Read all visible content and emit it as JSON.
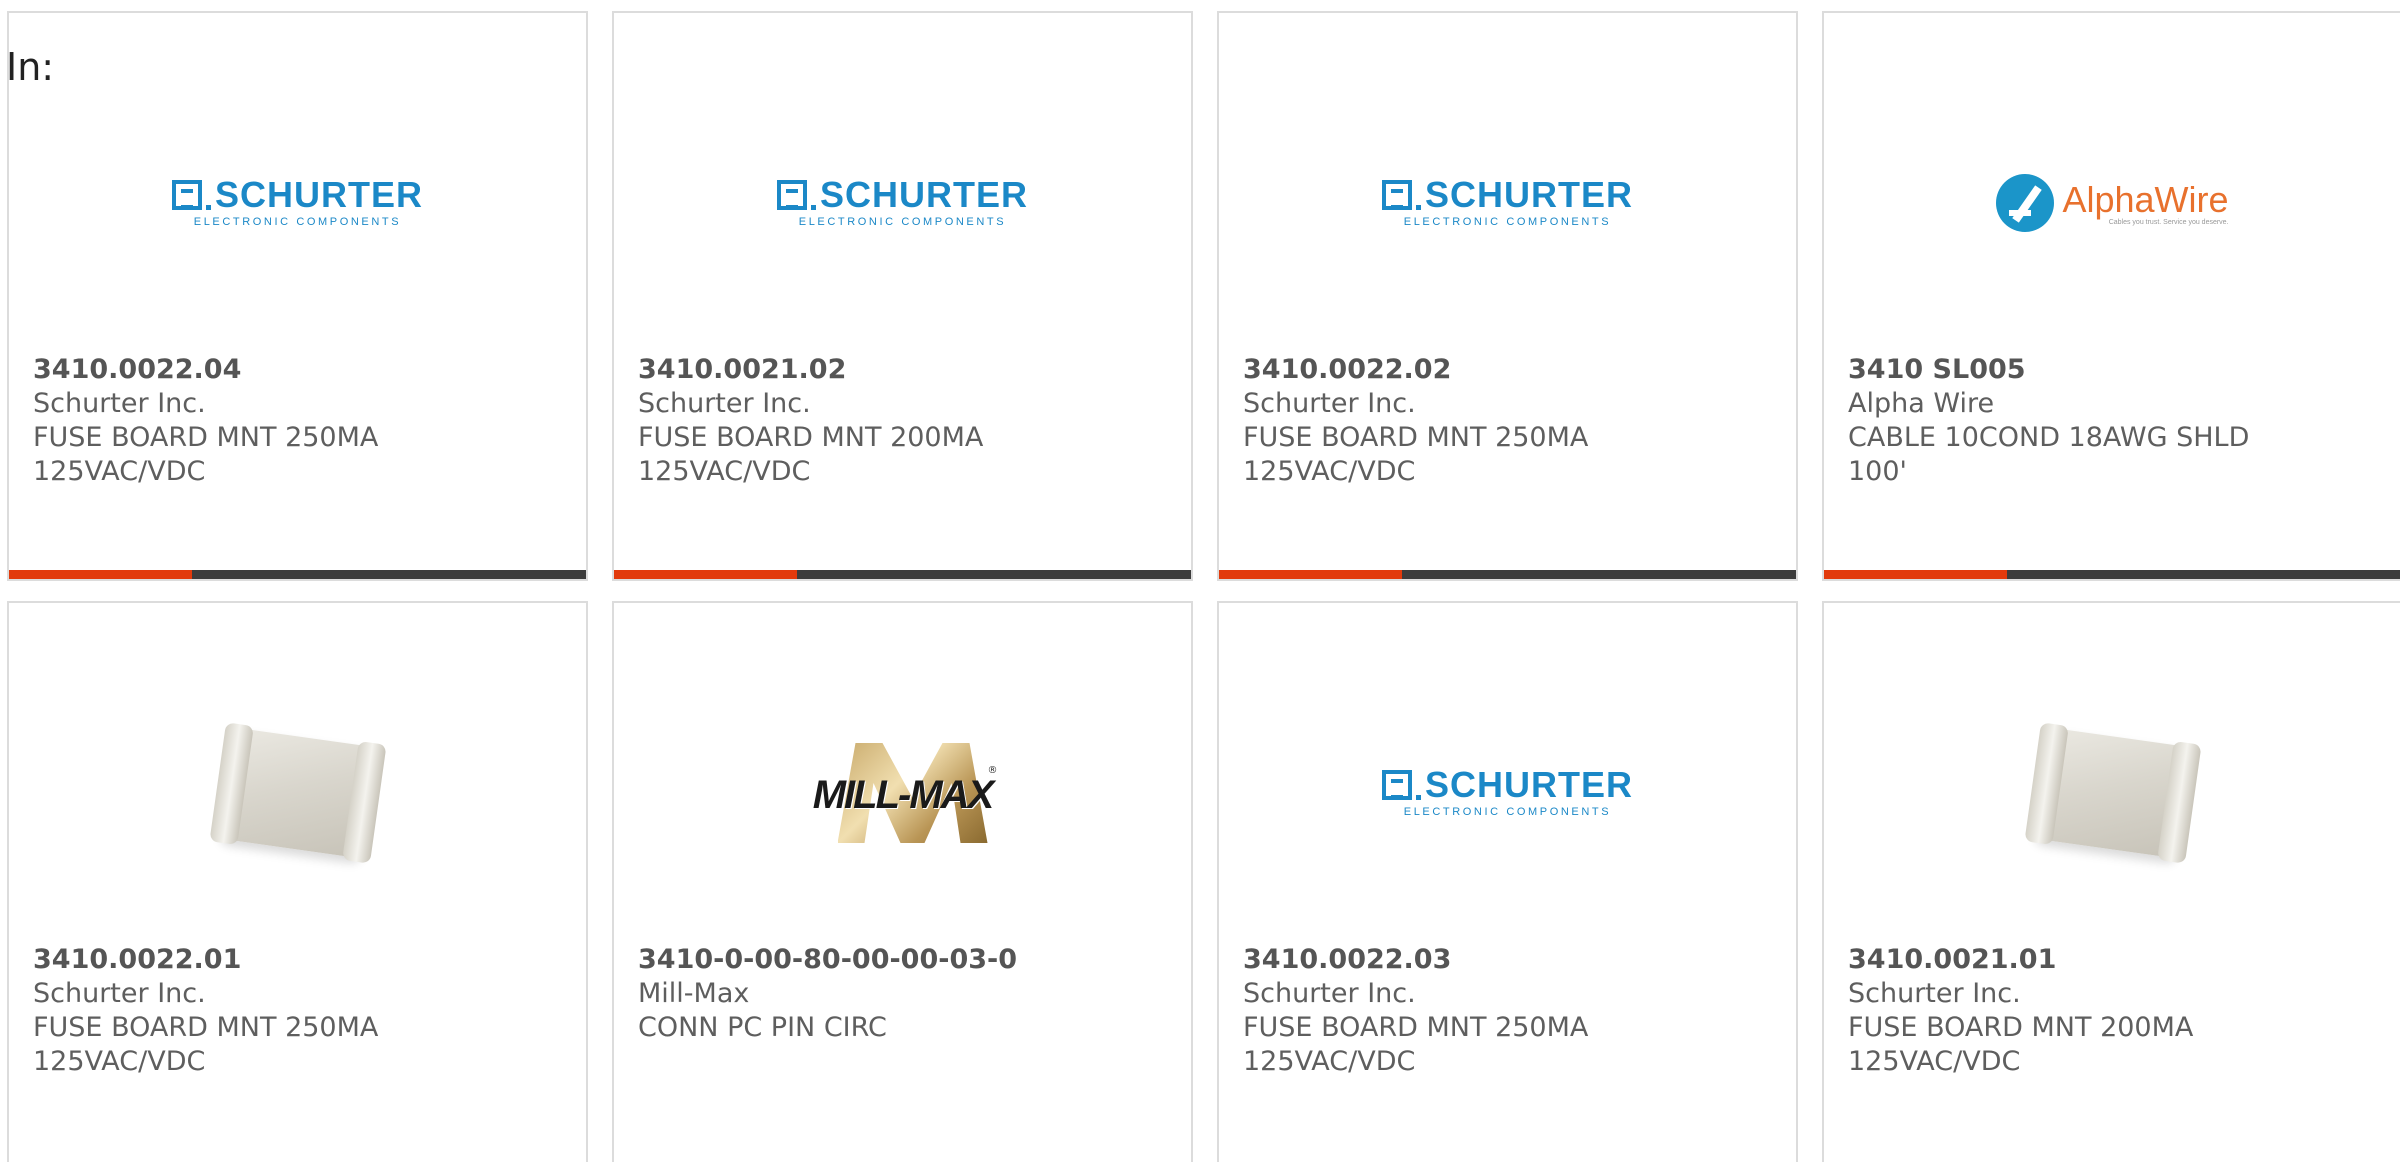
{
  "header": {
    "in_label": "In:"
  },
  "colors": {
    "accent": "#e23a0c",
    "bar": "#3c3c3c",
    "schurter_blue": "#1b88c7",
    "alphawire_orange": "#e8712d"
  },
  "products": [
    {
      "part": "3410.0022.04",
      "manufacturer": "Schurter Inc.",
      "desc1": "FUSE BOARD MNT 250MA",
      "desc2": "125VAC/VDC",
      "image": "schurter-logo"
    },
    {
      "part": "3410.0021.02",
      "manufacturer": "Schurter Inc.",
      "desc1": "FUSE BOARD MNT 200MA",
      "desc2": "125VAC/VDC",
      "image": "schurter-logo"
    },
    {
      "part": "3410.0022.02",
      "manufacturer": "Schurter Inc.",
      "desc1": "FUSE BOARD MNT 250MA",
      "desc2": "125VAC/VDC",
      "image": "schurter-logo"
    },
    {
      "part": "3410 SL005",
      "manufacturer": "Alpha Wire",
      "desc1": "CABLE 10COND 18AWG SHLD",
      "desc2": "100'",
      "image": "alphawire-logo"
    },
    {
      "part": "3410.0022.01",
      "manufacturer": "Schurter Inc.",
      "desc1": "FUSE BOARD MNT 250MA",
      "desc2": "125VAC/VDC",
      "image": "fuse-photo"
    },
    {
      "part": "3410-0-00-80-00-00-03-0",
      "manufacturer": "Mill-Max",
      "desc1": "CONN PC PIN CIRC",
      "desc2": "",
      "image": "millmax-logo"
    },
    {
      "part": "3410.0022.03",
      "manufacturer": "Schurter Inc.",
      "desc1": "FUSE BOARD MNT 250MA",
      "desc2": "125VAC/VDC",
      "image": "schurter-logo"
    },
    {
      "part": "3410.0021.01",
      "manufacturer": "Schurter Inc.",
      "desc1": "FUSE BOARD MNT 200MA",
      "desc2": "125VAC/VDC",
      "image": "fuse-photo"
    }
  ],
  "logos": {
    "schurter": {
      "name": "SCHURTER",
      "sub": "ELECTRONIC COMPONENTS"
    },
    "alphawire": {
      "name": "AlphaWire",
      "tag": "Cables you trust. Service you deserve."
    },
    "millmax": {
      "name": "MILL-MAX",
      "reg": "®"
    }
  }
}
